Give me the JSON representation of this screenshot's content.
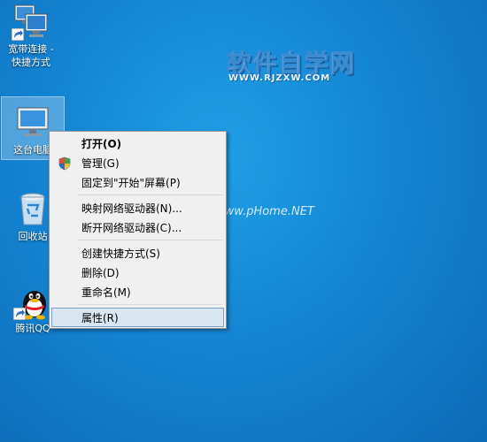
{
  "desktop": {
    "icons": [
      {
        "label": "宽带连接 -\n快捷方式"
      },
      {
        "label": "这台电脑"
      },
      {
        "label": "回收站"
      },
      {
        "label": "腾讯QQ"
      }
    ],
    "watermark": {
      "title": "软件自学网",
      "url": "WWW.RJZXW.COM",
      "mid": "www.pHome.NET"
    }
  },
  "context_menu": {
    "items": [
      {
        "label": "打开(O)"
      },
      {
        "label": "管理(G)",
        "icon": "uac-shield-icon"
      },
      {
        "label": "固定到\"开始\"屏幕(P)"
      },
      {
        "label": "映射网络驱动器(N)..."
      },
      {
        "label": "断开网络驱动器(C)..."
      },
      {
        "label": "创建快捷方式(S)"
      },
      {
        "label": "删除(D)"
      },
      {
        "label": "重命名(M)"
      },
      {
        "label": "属性(R)"
      }
    ]
  }
}
